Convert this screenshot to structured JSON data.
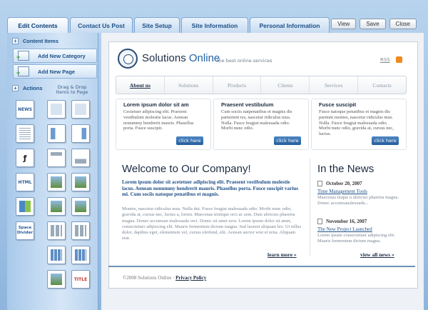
{
  "tabs": [
    "Edit Contents",
    "Contact Us Post",
    "Site Setup",
    "Site Information",
    "Personal Information"
  ],
  "top_buttons": [
    "View",
    "Save",
    "Close"
  ],
  "sidebar": {
    "content_items": "Content Items",
    "add_category": "Add New Category",
    "add_page": "Add New Page",
    "actions": "Actions",
    "drag_hint": "Drag & Drop Items to Page",
    "widget_labels": {
      "news": "NEWS",
      "html": "HTML",
      "space": "Space Divider",
      "title": "TITLE"
    }
  },
  "site": {
    "brand_a": "Solutions",
    "brand_b": "Online",
    "tagline": "the best online services",
    "rss": "RSS",
    "nav": [
      "About us",
      "Solutions",
      "Products",
      "Clients",
      "Services",
      "Contacts"
    ],
    "columns": [
      {
        "title": "Lorem ipsum dolor sit am",
        "text": "Cectetuer adipiscing elit. Praesent vestibulum molestie lacus. Aenean nonummy hendrerit mauris. Phasellus porta. Fusce suscipit.",
        "button": "click here"
      },
      {
        "title": "Praesent vestibulum",
        "text": "Cum sociis natpenatibus et magnis dis parturient tes, nascetur ridiculus mus. Nulla. Fusce feugiat malesuada odio. Morbi nunc odio.",
        "button": "click here"
      },
      {
        "title": "Fusce suscipit",
        "text": "Fusce natoque penatibus et magnis dis parimnt montes, nascetur ridiculus mus. Nulla. Fusce feugiat malesuada odio. Morbi nunc odio, gravida at, cursus nec, luctus.",
        "button": "click here"
      }
    ],
    "welcome_title": "Welcome to Our Company!",
    "welcome_lead": "Lorem ipsum dolor sit acetetuer adipiscing elit. Praesent vestibulum molestie lacus. Aenean nonummy hendrerit mauris. Phasellus porta. Fusce suscipit varius mi. Cum sociis natoque penatibus et magnis.",
    "welcome_body": "Montes, nascetur ridiculus mus. Nulla dui. Fusce feugiat malesuada odio. Morbi nunc odio, gravida at, cursus nec, luctus a, lorem. Maecenas tristique orci ac sem. Duis ultricies pharetra magna. Donec accumsan malesuada orci. Donec sit amet eros. Lorem ipsum dolor sit amet, consectetuer adipiscing elit. Mauris fermentum dictum magna. Sed laoreet aliquam leo. Ut tellus dolor, dapibus eget, elementum vel, cursus eleifend, elit. Aenean auctor wisi et urna. Aliquam erat.",
    "learn_more": "learn more »",
    "news_title": "In the News",
    "news": [
      {
        "date": "October 20, 2007",
        "headline": "Time Management Tools",
        "text": "Maecenas tisque u ultricies pharetra magna. Donec accumsanalesuada..."
      },
      {
        "date": "November 16, 2007",
        "headline": "The New Project Launched",
        "text": "Lorem ipsum consectetuer adipiscing elit. Mauris fermentum dictum magna."
      }
    ],
    "view_all": "view all news »",
    "footer_copy": "©2008 Solutions Online · ",
    "footer_link": "Privacy Policy"
  }
}
